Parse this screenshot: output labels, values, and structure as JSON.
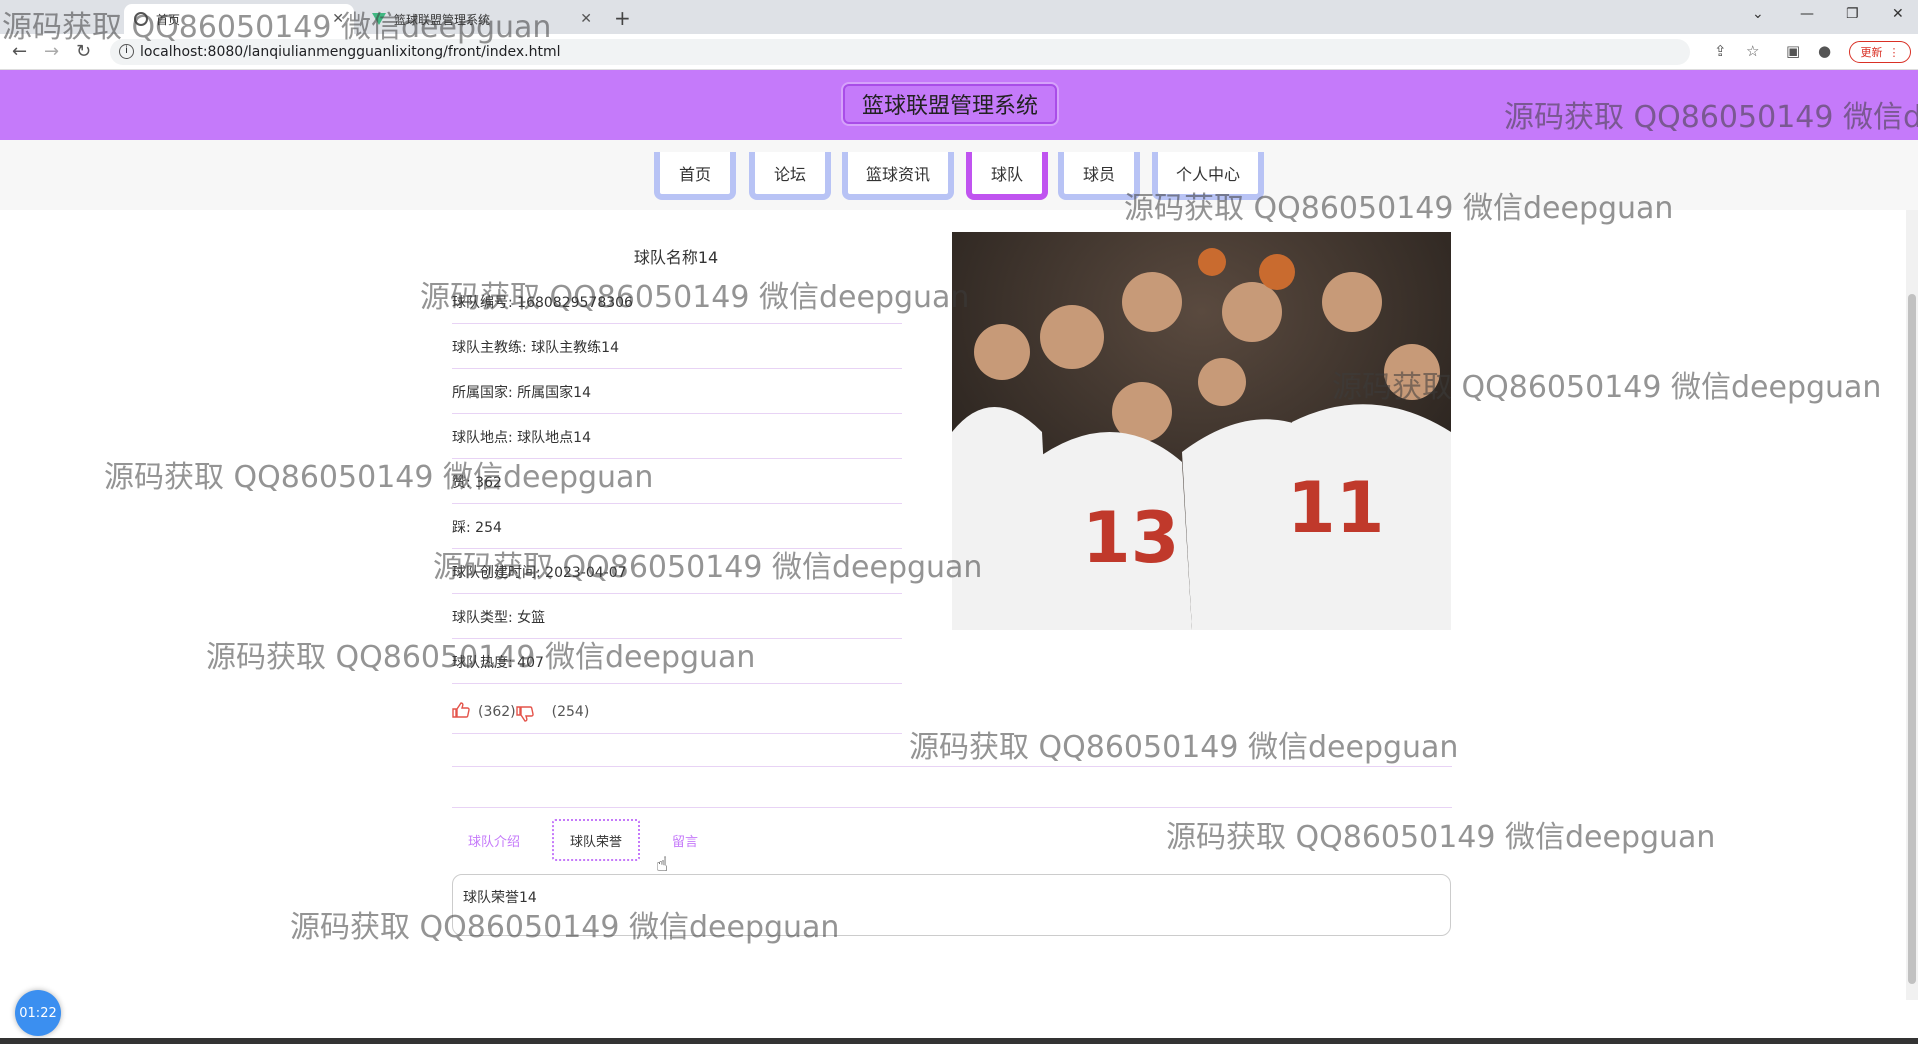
{
  "browser": {
    "tabs": [
      {
        "title": "首页"
      },
      {
        "title": "篮球联盟管理系统"
      }
    ],
    "new_tab": "+",
    "url": "localhost:8080/lanqiulianmengguanlixitong/front/index.html",
    "update_label": "更新"
  },
  "site": {
    "title": "篮球联盟管理系统",
    "nav": [
      {
        "label": "首页"
      },
      {
        "label": "论坛"
      },
      {
        "label": "篮球资讯"
      },
      {
        "label": "球队"
      },
      {
        "label": "球员"
      },
      {
        "label": "个人中心"
      }
    ],
    "active_nav": "球队"
  },
  "team": {
    "name": "球队名称14",
    "fields": [
      "球队编号: 1680829578306",
      "球队主教练: 球队主教练14",
      "所属国家: 所属国家14",
      "球队地点: 球队地点14",
      "赞: 362",
      "踩: 254",
      "球队创建时间: 2023-04-07",
      "球队类型: 女篮",
      "球队热度: 407"
    ],
    "likes": "(362)",
    "dislikes": "(254)"
  },
  "detail_tabs": [
    {
      "label": "球队介绍"
    },
    {
      "label": "球队荣誉"
    },
    {
      "label": "留言"
    }
  ],
  "active_tab": "球队荣誉",
  "content": "球队荣誉14",
  "timer": "01:22",
  "watermark": "源码获取 QQ86050149 微信deepguan",
  "colors": {
    "header": "#c57afa",
    "nav_border": "#b8c3f5",
    "active": "#c054f0"
  }
}
